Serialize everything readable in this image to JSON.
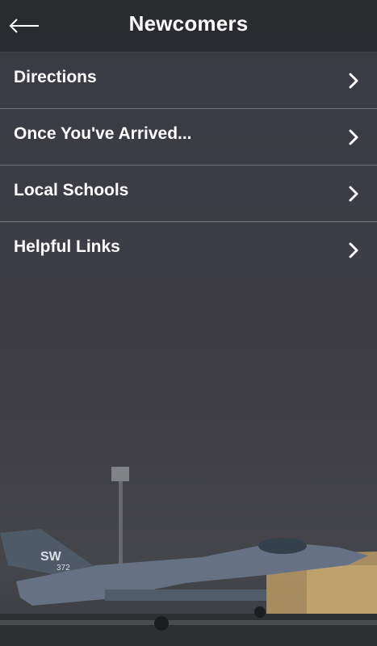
{
  "header": {
    "title": "Newcomers",
    "back_icon": "arrow-left-icon"
  },
  "menu": {
    "items": [
      {
        "label": "Directions",
        "icon": "chevron-right-icon"
      },
      {
        "label": "Once You've Arrived...",
        "icon": "chevron-right-icon"
      },
      {
        "label": "Local Schools",
        "icon": "chevron-right-icon"
      },
      {
        "label": "Helpful Links",
        "icon": "chevron-right-icon"
      }
    ]
  },
  "background": {
    "jet_tail_text": "SW",
    "jet_tail_number": "372"
  },
  "colors": {
    "header_bg": "#28292e",
    "row_bg": "#3e3f46",
    "text": "#ffffff",
    "page_bg": "#3a3a40"
  }
}
